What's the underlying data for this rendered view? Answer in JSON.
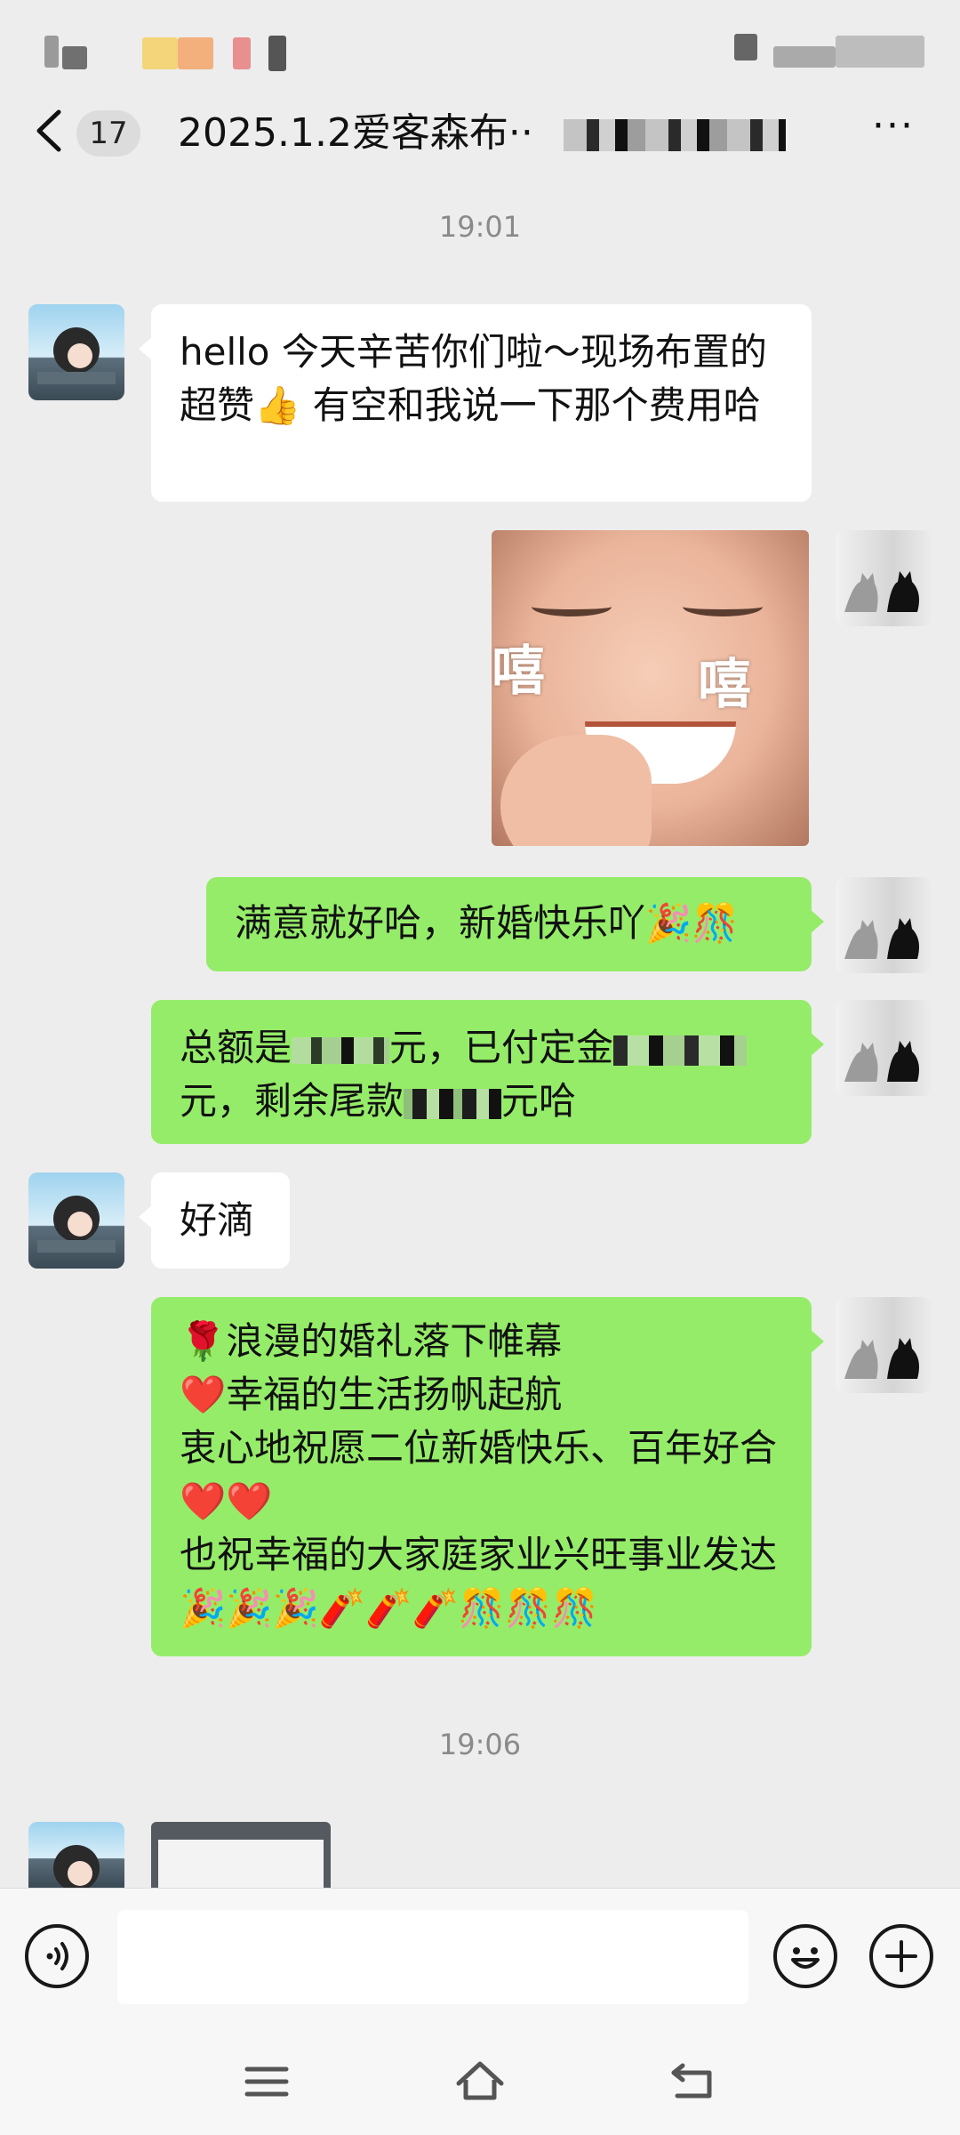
{
  "header": {
    "back_label": "<",
    "unread_count": "17",
    "title": "2025.1.2爱客森布··",
    "more_label": "···"
  },
  "messages": [
    {
      "type": "timestamp",
      "text": "19:01"
    },
    {
      "type": "text",
      "side": "in",
      "text": "hello 今天辛苦你们啦～现场布置的超赞👍 有空和我说一下那个费用哈"
    },
    {
      "type": "sticker",
      "side": "out",
      "left_char": "嘻",
      "right_char": "嘻"
    },
    {
      "type": "text",
      "side": "out",
      "text": "满意就好哈，新婚快乐吖🎉🎊"
    },
    {
      "type": "text",
      "side": "out",
      "line1_a": "总额是",
      "line1_b": "元，已付定金",
      "line2_a": "元，剩余尾款",
      "line2_b": "元哈"
    },
    {
      "type": "text",
      "side": "in",
      "text": "好滴"
    },
    {
      "type": "text",
      "side": "out",
      "text": "🌹浪漫的婚礼落下帷幕\n❤️幸福的生活扬帆起航\n衷心地祝愿二位新婚快乐、百年好合❤️❤️\n也祝幸福的大家庭家业兴旺事业发达🎉🎉🎉🧨🧨🧨🎊🎊🎊"
    },
    {
      "type": "timestamp",
      "text": "19:06"
    },
    {
      "type": "image",
      "side": "in"
    }
  ],
  "input_bar": {
    "voice_icon": "voice-icon",
    "emoji_icon": "emoji-icon",
    "plus_icon": "plus-icon"
  },
  "nav_bar": {
    "menu_icon": "menu-icon",
    "home_icon": "home-icon",
    "back_icon": "back-icon"
  },
  "colors": {
    "background": "#ededed",
    "bubble_out": "#95ec69",
    "bubble_in": "#ffffff",
    "timestamp_text": "#8a8a8a"
  }
}
